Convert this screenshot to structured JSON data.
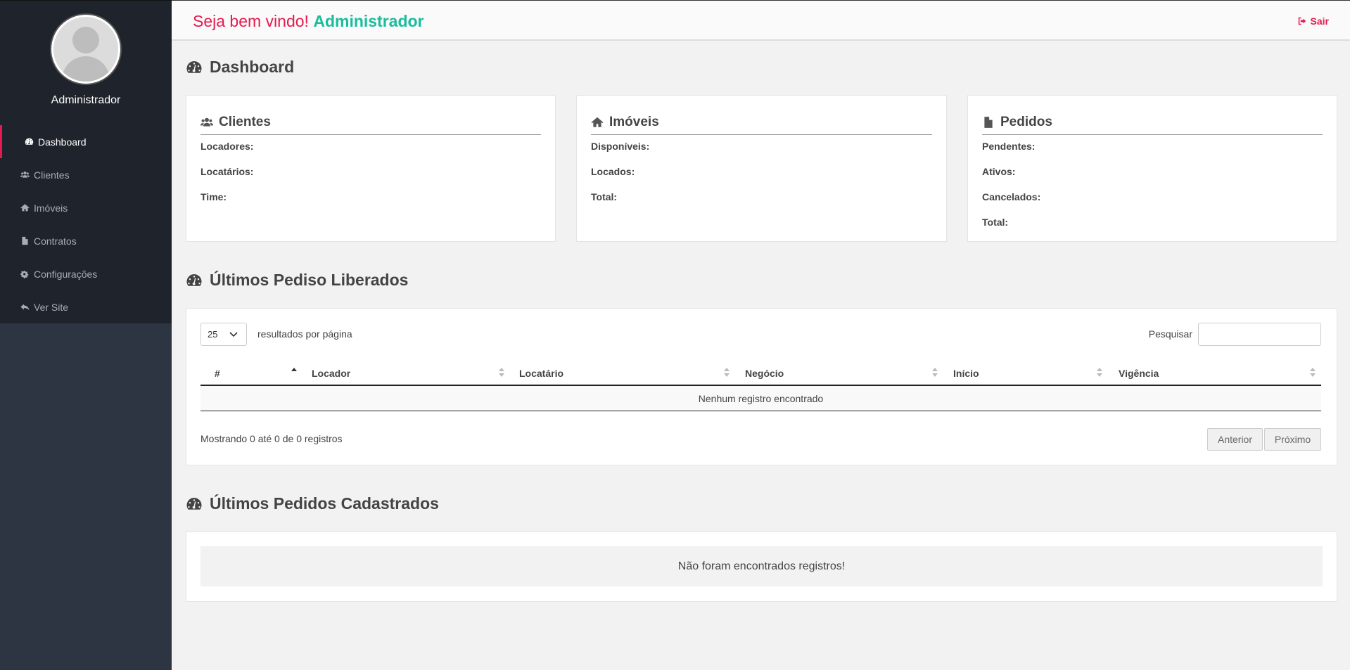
{
  "sidebar": {
    "user_name": "Administrador",
    "items": [
      {
        "label": "Dashboard",
        "icon": "dashboard-icon",
        "active": true
      },
      {
        "label": "Clientes",
        "icon": "users-icon"
      },
      {
        "label": "Imóveis",
        "icon": "home-icon"
      },
      {
        "label": "Contratos",
        "icon": "file-icon"
      },
      {
        "label": "Configurações",
        "icon": "gears-icon"
      },
      {
        "label": "Ver Site",
        "icon": "reply-icon"
      }
    ]
  },
  "header": {
    "welcome": "Seja bem vindo!",
    "user": "Administrador",
    "logout": "Sair"
  },
  "page_title": "Dashboard",
  "cards": {
    "clientes": {
      "title": "Clientes",
      "stats": [
        "Locadores:",
        "Locatários:",
        "Time:"
      ]
    },
    "imoveis": {
      "title": "Imóveis",
      "stats": [
        "Disponíveis:",
        "Locados:",
        "Total:"
      ]
    },
    "pedidos": {
      "title": "Pedidos",
      "stats": [
        "Pendentes:",
        "Ativos:",
        "Cancelados:",
        "Total:"
      ]
    }
  },
  "released": {
    "title": "Últimos Pediso Liberados",
    "page_size": "25",
    "page_size_label": "resultados por página",
    "search_label": "Pesquisar",
    "columns": [
      "#",
      "Locador",
      "Locatário",
      "Negócio",
      "Início",
      "Vigência"
    ],
    "empty": "Nenhum registro encontrado",
    "info": "Mostrando 0 até 0 de 0 registros",
    "prev": "Anterior",
    "next": "Próximo"
  },
  "registered": {
    "title": "Últimos Pedidos Cadastrados",
    "empty": "Não foram encontrados registros!"
  },
  "colors": {
    "accent": "#e5194f",
    "highlight": "#1abc9c",
    "sidebar_dark": "#1f232b",
    "sidebar": "#2d3442"
  }
}
